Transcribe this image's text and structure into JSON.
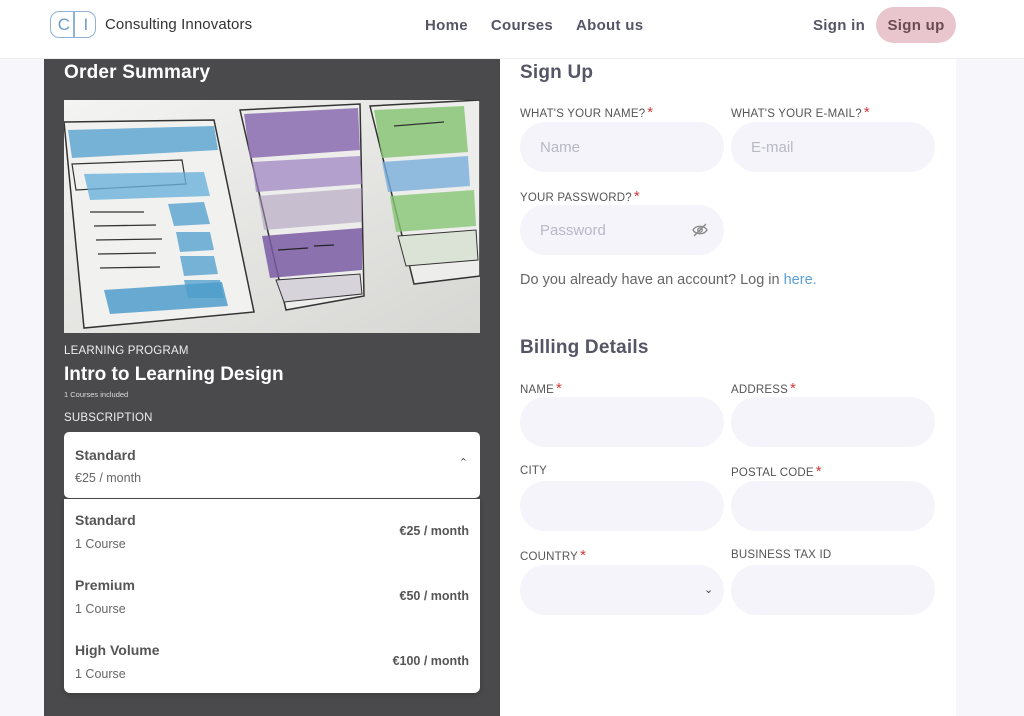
{
  "header": {
    "logo_letters": [
      "C",
      "I"
    ],
    "brand": "Consulting Innovators",
    "nav": [
      "Home",
      "Courses",
      "About us"
    ],
    "sign_in": "Sign in",
    "sign_up": "Sign up"
  },
  "order": {
    "title": "Order Summary",
    "program_label": "LEARNING PROGRAM",
    "program_title": "Intro to Learning Design",
    "courses_included": "1 Courses included",
    "subscription_label": "SUBSCRIPTION",
    "selected": {
      "name": "Standard",
      "price": "€25 / month"
    },
    "options": [
      {
        "name": "Standard",
        "count": "1 Course",
        "price": "€25 / month"
      },
      {
        "name": "Premium",
        "count": "1 Course",
        "price": "€50 / month"
      },
      {
        "name": "High Volume",
        "count": "1 Course",
        "price": "€100 / month"
      }
    ]
  },
  "signup": {
    "title": "Sign Up",
    "name_label": "WHAT'S YOUR NAME?",
    "name_placeholder": "Name",
    "email_label": "WHAT'S YOUR E-MAIL?",
    "email_placeholder": "E-mail",
    "password_label": "YOUR PASSWORD?",
    "password_placeholder": "Password",
    "login_text": "Do you already have an account? Log in",
    "login_link": "here."
  },
  "billing": {
    "title": "Billing Details",
    "name_label": "NAME",
    "address_label": "ADDRESS",
    "city_label": "CITY",
    "postal_label": "POSTAL CODE",
    "country_label": "COUNTRY",
    "tax_label": "BUSINESS TAX ID"
  },
  "required_mark": "*",
  "colors": {
    "accent_link": "#5a9fd6",
    "required": "#d23a3a",
    "signup_button": "#e9c6cd",
    "left_panel": "#4a4a4c"
  }
}
